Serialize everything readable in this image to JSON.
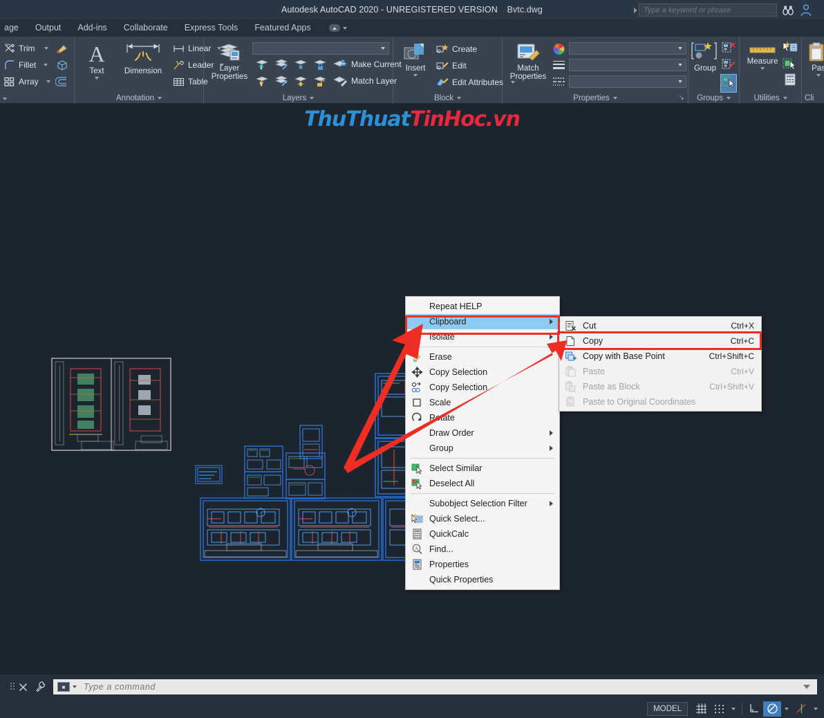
{
  "titlebar": {
    "app_title": "Autodesk AutoCAD 2020 - UNREGISTERED VERSION",
    "document_name": "Bvtc.dwg",
    "search_placeholder": "Type a keyword or phrase",
    "icons": [
      "infocenter-caret-icon",
      "search-binoculars-icon",
      "signin-person-icon"
    ]
  },
  "tabs": [
    {
      "label": "age"
    },
    {
      "label": "Output"
    },
    {
      "label": "Add-ins"
    },
    {
      "label": "Collaborate"
    },
    {
      "label": "Express Tools"
    },
    {
      "label": "Featured Apps"
    }
  ],
  "ribbon": {
    "panels": [
      {
        "id": "modify",
        "label": "",
        "items": [
          {
            "label": "Trim",
            "icon": "trim-icon",
            "has_caret": true
          },
          {
            "label": "Fillet",
            "icon": "fillet-icon",
            "has_caret": true
          },
          {
            "label": "Array",
            "icon": "array-icon",
            "has_caret": true
          },
          {
            "label": "",
            "icon": "erase-brush-icon",
            "has_caret": false
          },
          {
            "label": "",
            "icon": "3d-box-icon",
            "has_caret": false
          },
          {
            "label": "",
            "icon": "offset-icon",
            "has_caret": false
          }
        ]
      },
      {
        "id": "annotation",
        "label": "Annotation",
        "big_buttons": [
          {
            "label": "Text",
            "icon": "text-a-icon",
            "has_caret": true
          },
          {
            "label": "Dimension",
            "icon": "dimension-icon",
            "has_caret": false
          }
        ],
        "items": [
          {
            "label": "Linear",
            "icon": "linear-dim-icon",
            "has_caret": true
          },
          {
            "label": "Leader",
            "icon": "leader-icon",
            "has_caret": true
          },
          {
            "label": "Table",
            "icon": "table-icon",
            "has_caret": false
          }
        ]
      },
      {
        "id": "layers",
        "label": "Layers",
        "big_buttons": [
          {
            "label": "Layer Properties",
            "icon": "layer-properties-icon"
          }
        ],
        "combo_value": "",
        "items": [
          {
            "label": "Make Current",
            "icon": "make-current-icon"
          },
          {
            "label": "Match Layer",
            "icon": "match-layer-icon"
          }
        ],
        "small_icons": [
          "layer-isolate-icon",
          "layer-unisolate-icon",
          "layer-freeze-icon",
          "layer-lock-icon",
          "layer-off-icon",
          "layer-turn-all-on-icon",
          "layer-thaw-icon",
          "layer-unlock-icon"
        ]
      },
      {
        "id": "block",
        "label": "Block",
        "big_buttons": [
          {
            "label": "Insert",
            "icon": "insert-block-icon",
            "has_caret": true
          }
        ],
        "items": [
          {
            "label": "Create",
            "icon": "create-block-icon",
            "has_caret": false
          },
          {
            "label": "Edit",
            "icon": "edit-block-icon",
            "has_caret": false
          },
          {
            "label": "Edit Attributes",
            "icon": "edit-attributes-icon",
            "has_caret": true
          }
        ]
      },
      {
        "id": "properties",
        "label": "Properties",
        "big_buttons": [
          {
            "label": "Match Properties",
            "icon": "match-properties-icon"
          }
        ],
        "prop_icons": [
          "color-wheel-icon",
          "lineweight-icon",
          "linetype-icon"
        ],
        "combos": [
          "",
          "",
          ""
        ]
      },
      {
        "id": "groups",
        "label": "Groups",
        "big_buttons": [
          {
            "label": "Group",
            "icon": "group-icon"
          }
        ],
        "small_icons": [
          "ungroup-icon",
          "group-edit-icon",
          "group-selection-toggle-icon"
        ]
      },
      {
        "id": "utilities",
        "label": "Utilities",
        "big_buttons": [
          {
            "label": "Measure",
            "icon": "measure-ruler-icon",
            "has_caret": true
          }
        ],
        "small_icons": [
          "quick-select-icon",
          "select-similar-icon",
          "quickcalc-icon"
        ]
      },
      {
        "id": "clipboard",
        "label": "Cli",
        "big_buttons": [
          {
            "label": "Pas",
            "icon": "paste-icon",
            "has_caret": true
          }
        ]
      }
    ]
  },
  "canvas": {
    "watermark_blue": "ThuThuat",
    "watermark_red": "TinHoc.vn"
  },
  "context_menu": {
    "items": [
      {
        "label": "Repeat HELP",
        "icon": null,
        "submenu": false,
        "selected": false,
        "sep_after": false
      },
      {
        "label": "Clipboard",
        "icon": null,
        "submenu": true,
        "selected": true,
        "sep_after": false
      },
      {
        "label": "Isolate",
        "icon": null,
        "submenu": true,
        "selected": false,
        "sep_after": true
      },
      {
        "label": "Erase",
        "icon": "erase-icon",
        "submenu": false,
        "selected": false,
        "sep_after": false
      },
      {
        "label": "Move",
        "icon": "move-icon",
        "submenu": false,
        "selected": false,
        "sep_after": false
      },
      {
        "label": "Copy Selection",
        "icon": "copy-selection-icon",
        "submenu": false,
        "selected": false,
        "sep_after": false
      },
      {
        "label": "Scale",
        "icon": "scale-icon",
        "submenu": false,
        "selected": false,
        "sep_after": false
      },
      {
        "label": "Rotate",
        "icon": "rotate-icon",
        "submenu": false,
        "selected": false,
        "sep_after": false
      },
      {
        "label": "Draw Order",
        "icon": null,
        "submenu": true,
        "selected": false,
        "sep_after": false
      },
      {
        "label": "Group",
        "icon": null,
        "submenu": true,
        "selected": false,
        "sep_after": true
      },
      {
        "label": "Select Similar",
        "icon": "select-similar-icon",
        "submenu": false,
        "selected": false,
        "sep_after": false
      },
      {
        "label": "Deselect All",
        "icon": "deselect-all-icon",
        "submenu": false,
        "selected": false,
        "sep_after": true
      },
      {
        "label": "Subobject Selection Filter",
        "icon": null,
        "submenu": true,
        "selected": false,
        "sep_after": false
      },
      {
        "label": "Quick Select...",
        "icon": "quick-select-icon",
        "submenu": false,
        "selected": false,
        "sep_after": false
      },
      {
        "label": "QuickCalc",
        "icon": "quickcalc-icon",
        "submenu": false,
        "selected": false,
        "sep_after": false
      },
      {
        "label": "Find...",
        "icon": "find-icon",
        "submenu": false,
        "selected": false,
        "sep_after": false
      },
      {
        "label": "Properties",
        "icon": "properties-icon",
        "submenu": false,
        "selected": false,
        "sep_after": false
      },
      {
        "label": "Quick Properties",
        "icon": null,
        "submenu": false,
        "selected": false,
        "sep_after": false
      }
    ]
  },
  "clipboard_submenu": {
    "items": [
      {
        "label": "Cut",
        "shortcut": "Ctrl+X",
        "icon": "cut-icon",
        "disabled": false
      },
      {
        "label": "Copy",
        "shortcut": "Ctrl+C",
        "icon": "copy-icon",
        "disabled": false
      },
      {
        "label": "Copy with Base Point",
        "shortcut": "Ctrl+Shift+C",
        "icon": "copy-base-point-icon",
        "disabled": false
      },
      {
        "label": "Paste",
        "shortcut": "Ctrl+V",
        "icon": "paste-icon",
        "disabled": true
      },
      {
        "label": "Paste as Block",
        "shortcut": "Ctrl+Shift+V",
        "icon": "paste-block-icon",
        "disabled": true
      },
      {
        "label": "Paste to Original Coordinates",
        "shortcut": "",
        "icon": "paste-original-icon",
        "disabled": true
      }
    ]
  },
  "command_line": {
    "placeholder": "Type a command",
    "value": ""
  },
  "statusbar": {
    "model_label": "MODEL",
    "buttons": [
      "grid-display-icon",
      "snap-mode-icon",
      "snap-caret-icon",
      "ortho-mode-icon",
      "polar-tracking-icon",
      "polar-caret-icon",
      "object-snap-icon",
      "osnap-caret-icon"
    ]
  },
  "colors": {
    "accent_highlight": "#8ecbf2",
    "annotation_red": "#ee2d24",
    "canvas_bg": "#1c242e",
    "ribbon_bg": "#39424f",
    "cad_blue": "#2a6fd6"
  }
}
